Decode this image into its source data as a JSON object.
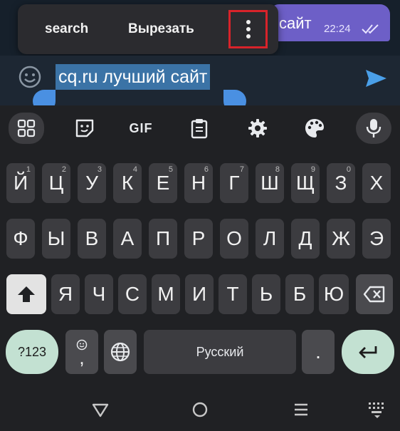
{
  "chat": {
    "message_text": "сайт",
    "message_time": "22:24",
    "input_text": "cq.ru лучший сайт"
  },
  "context_menu": {
    "search_label": "search",
    "cut_label": "Вырезать"
  },
  "toolbar": {
    "gif_label": "GIF"
  },
  "keyboard": {
    "row1": [
      {
        "label": "Й",
        "hint": "1"
      },
      {
        "label": "Ц",
        "hint": "2"
      },
      {
        "label": "У",
        "hint": "3"
      },
      {
        "label": "К",
        "hint": "4"
      },
      {
        "label": "Е",
        "hint": "5"
      },
      {
        "label": "Н",
        "hint": "6"
      },
      {
        "label": "Г",
        "hint": "7"
      },
      {
        "label": "Ш",
        "hint": "8"
      },
      {
        "label": "Щ",
        "hint": "9"
      },
      {
        "label": "З",
        "hint": "0"
      },
      {
        "label": "Х",
        "hint": ""
      }
    ],
    "row2": [
      "Ф",
      "Ы",
      "В",
      "А",
      "П",
      "Р",
      "О",
      "Л",
      "Д",
      "Ж",
      "Э"
    ],
    "row3": [
      "Я",
      "Ч",
      "С",
      "М",
      "И",
      "Т",
      "Ь",
      "Б",
      "Ю"
    ],
    "symbols_label": "?123",
    "emoji_comma_label": ",",
    "space_label": "Русский",
    "period_label": "."
  },
  "colors": {
    "accent_green": "#c3e1d2",
    "selection_blue": "#3b73a6",
    "handle_blue": "#4a90e2",
    "highlight_red": "#d8232a"
  }
}
